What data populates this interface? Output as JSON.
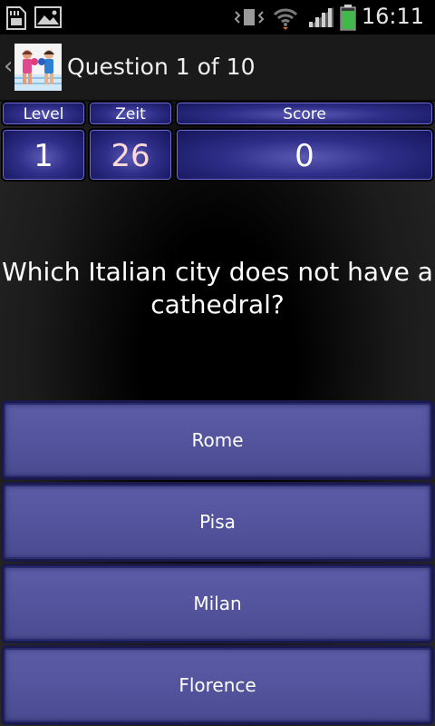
{
  "status_bar": {
    "time": "16:11",
    "icons": [
      "sd-card-icon",
      "image-icon",
      "vibrate-icon",
      "wifi-icon",
      "signal-icon",
      "battery-icon"
    ]
  },
  "action_bar": {
    "title": "Question 1 of 10",
    "app_icon": "boxing-app-icon"
  },
  "stats": {
    "level_label": "Level",
    "level_value": "1",
    "zeit_label": "Zeit",
    "zeit_value": "26",
    "score_label": "Score",
    "score_value": "0"
  },
  "question": {
    "text": "Which Italian city does not have a cathedral?"
  },
  "answers": [
    "Rome",
    "Pisa",
    "Milan",
    "Florence"
  ],
  "colors": {
    "stat_box": "#2e2e88",
    "answer_button": "#54549e",
    "background": "#000000"
  }
}
